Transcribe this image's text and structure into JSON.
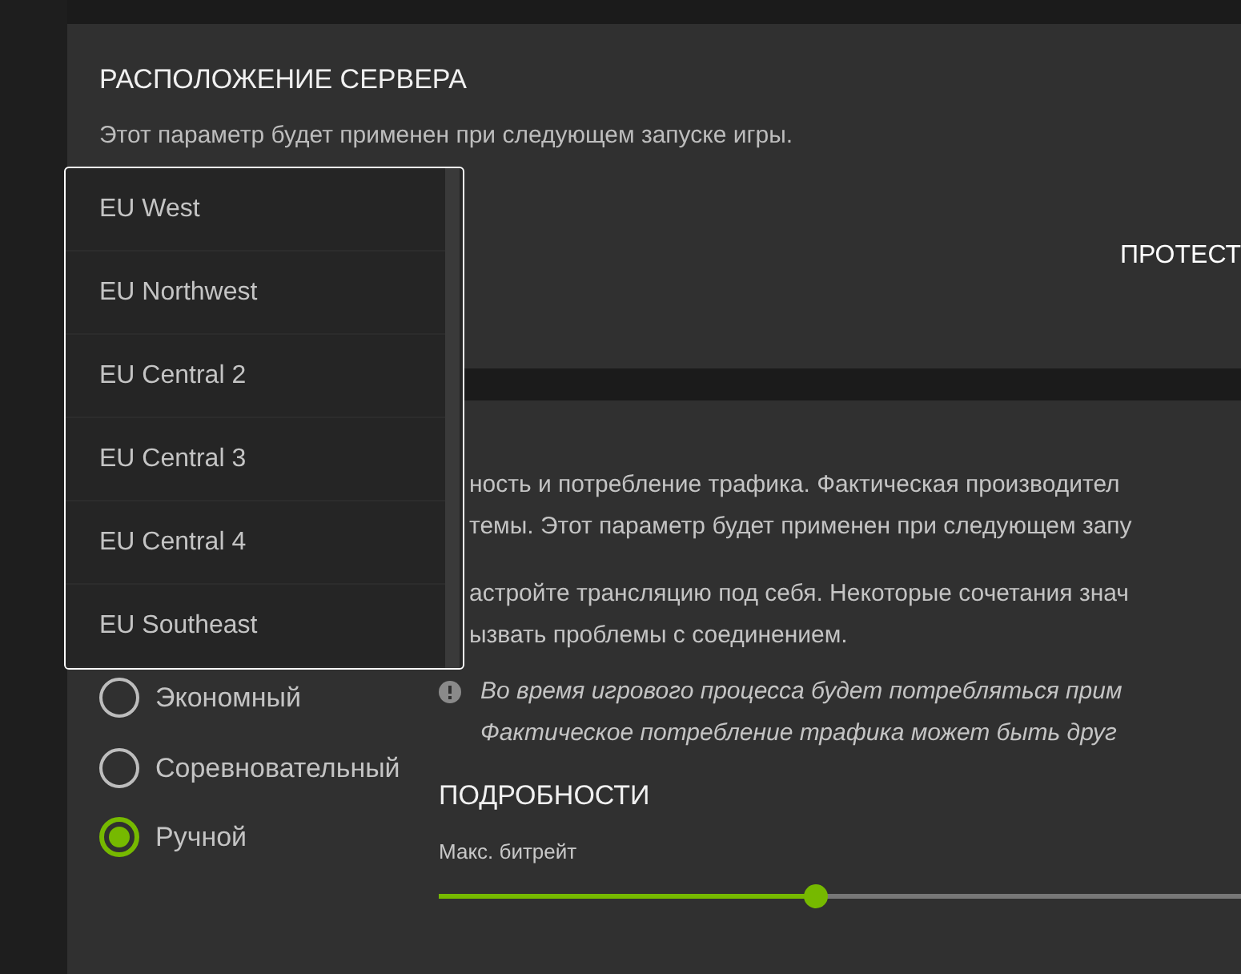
{
  "server_location": {
    "title": "РАСПОЛОЖЕНИЕ СЕРВЕРА",
    "note": "Этот параметр будет применен при следующем запуске игры.",
    "test_button": "ПРОТЕСТ",
    "dropdown_options": [
      {
        "label": "EU West"
      },
      {
        "label": "EU Northwest"
      },
      {
        "label": "EU Central 2"
      },
      {
        "label": "EU Central 3"
      },
      {
        "label": "EU Central 4"
      },
      {
        "label": "EU Southeast"
      }
    ]
  },
  "streaming": {
    "description": [
      "ность и потребление трафика. Фактическая производител",
      "темы. Этот параметр будет применен при следующем запу"
    ],
    "manual_note": [
      "астройте трансляцию под себя. Некоторые сочетания знач",
      "ызвать проблемы с соединением."
    ],
    "warning": [
      "Во время игрового процесса будет потребляться прим",
      "Фактическое потребление трафика может быть друг"
    ],
    "presets": [
      {
        "label": "Экономный",
        "selected": false
      },
      {
        "label": "Соревновательный",
        "selected": false
      },
      {
        "label": "Ручной",
        "selected": true
      }
    ],
    "details_title": "ПОДРОБНОСТИ",
    "slider": {
      "label": "Макс. битрейт",
      "level": 0.47
    }
  }
}
